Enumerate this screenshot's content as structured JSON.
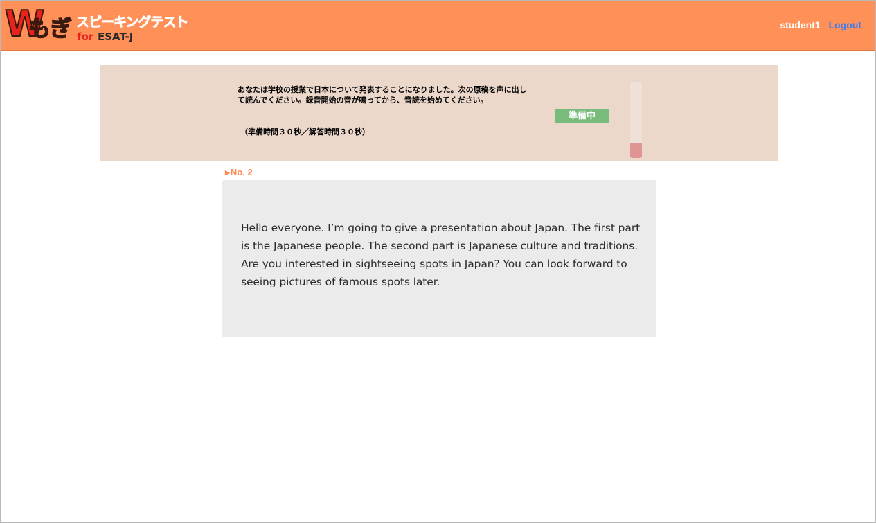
{
  "header": {
    "logo_w": "W",
    "logo_mogi": "もぎ",
    "logo_title": "スピーキングテスト",
    "logo_for": "for",
    "logo_esat": "ESAT-J",
    "username": "student1",
    "logout_label": "Logout",
    "background_color": "#ff9057"
  },
  "instruction": {
    "text": "あなたは学校の授業で日本について発表することになりました。次の原稿を声に出して読んでください。録音開始の音が鳴ってから、音読を始めてください。",
    "time_note": "（準備時間３０秒／解答時間３０秒）",
    "status": "準備中",
    "status_color": "#79bb7b",
    "timer_progress": 0.2
  },
  "question": {
    "number_label": "No. 2",
    "passage": "Hello everyone. I’m going to give a presentation about Japan. The first part is the Japanese people. The second part is Japanese culture and traditions. Are you interested in sightseeing spots in Japan? You can look forward to seeing pictures of famous spots later."
  }
}
